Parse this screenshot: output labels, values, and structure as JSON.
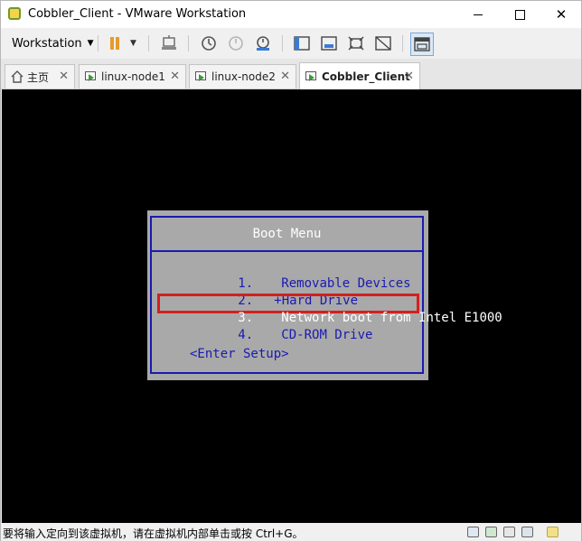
{
  "window": {
    "title": "Cobbler_Client - VMware Workstation",
    "minimize": "—",
    "maximize": "□",
    "close": "✕"
  },
  "toolbar": {
    "workstation_label": "Workstation",
    "dropdown_caret": "▼",
    "icons": [
      "pause-icon",
      "send-keys-icon",
      "snapshot-take-icon",
      "snapshot-revert-icon",
      "snapshot-manager-icon",
      "console-view-icon",
      "fullscreen-icon",
      "unity-icon",
      "stretch-icon",
      "library-icon"
    ]
  },
  "tabs": [
    {
      "label": "主页",
      "icon": "home-icon",
      "close": "✕"
    },
    {
      "label": "linux-node1",
      "icon": "vm-icon",
      "close": "✕"
    },
    {
      "label": "linux-node2",
      "icon": "vm-icon",
      "close": "✕"
    },
    {
      "label": "Cobbler_Client",
      "icon": "vm-icon",
      "close": "✕",
      "active": true
    }
  ],
  "boot_menu": {
    "title": "Boot Menu",
    "items": [
      {
        "num": "1.",
        "label": "Removable Devices"
      },
      {
        "num": "2.",
        "label": "+Hard Drive"
      },
      {
        "num": "3.",
        "label": "Network boot from Intel E1000",
        "selected": true
      },
      {
        "num": "4.",
        "label": "CD-ROM Drive"
      }
    ],
    "setup": "<Enter Setup>"
  },
  "statusbar": {
    "message": "要将输入定向到该虚拟机，请在虚拟机内部单击或按 Ctrl+G。"
  },
  "colors": {
    "boot_bg": "#a9a9a9",
    "boot_fg": "#1a1ab0",
    "highlight": "#d41f1f",
    "pause": "#e89a2c"
  }
}
